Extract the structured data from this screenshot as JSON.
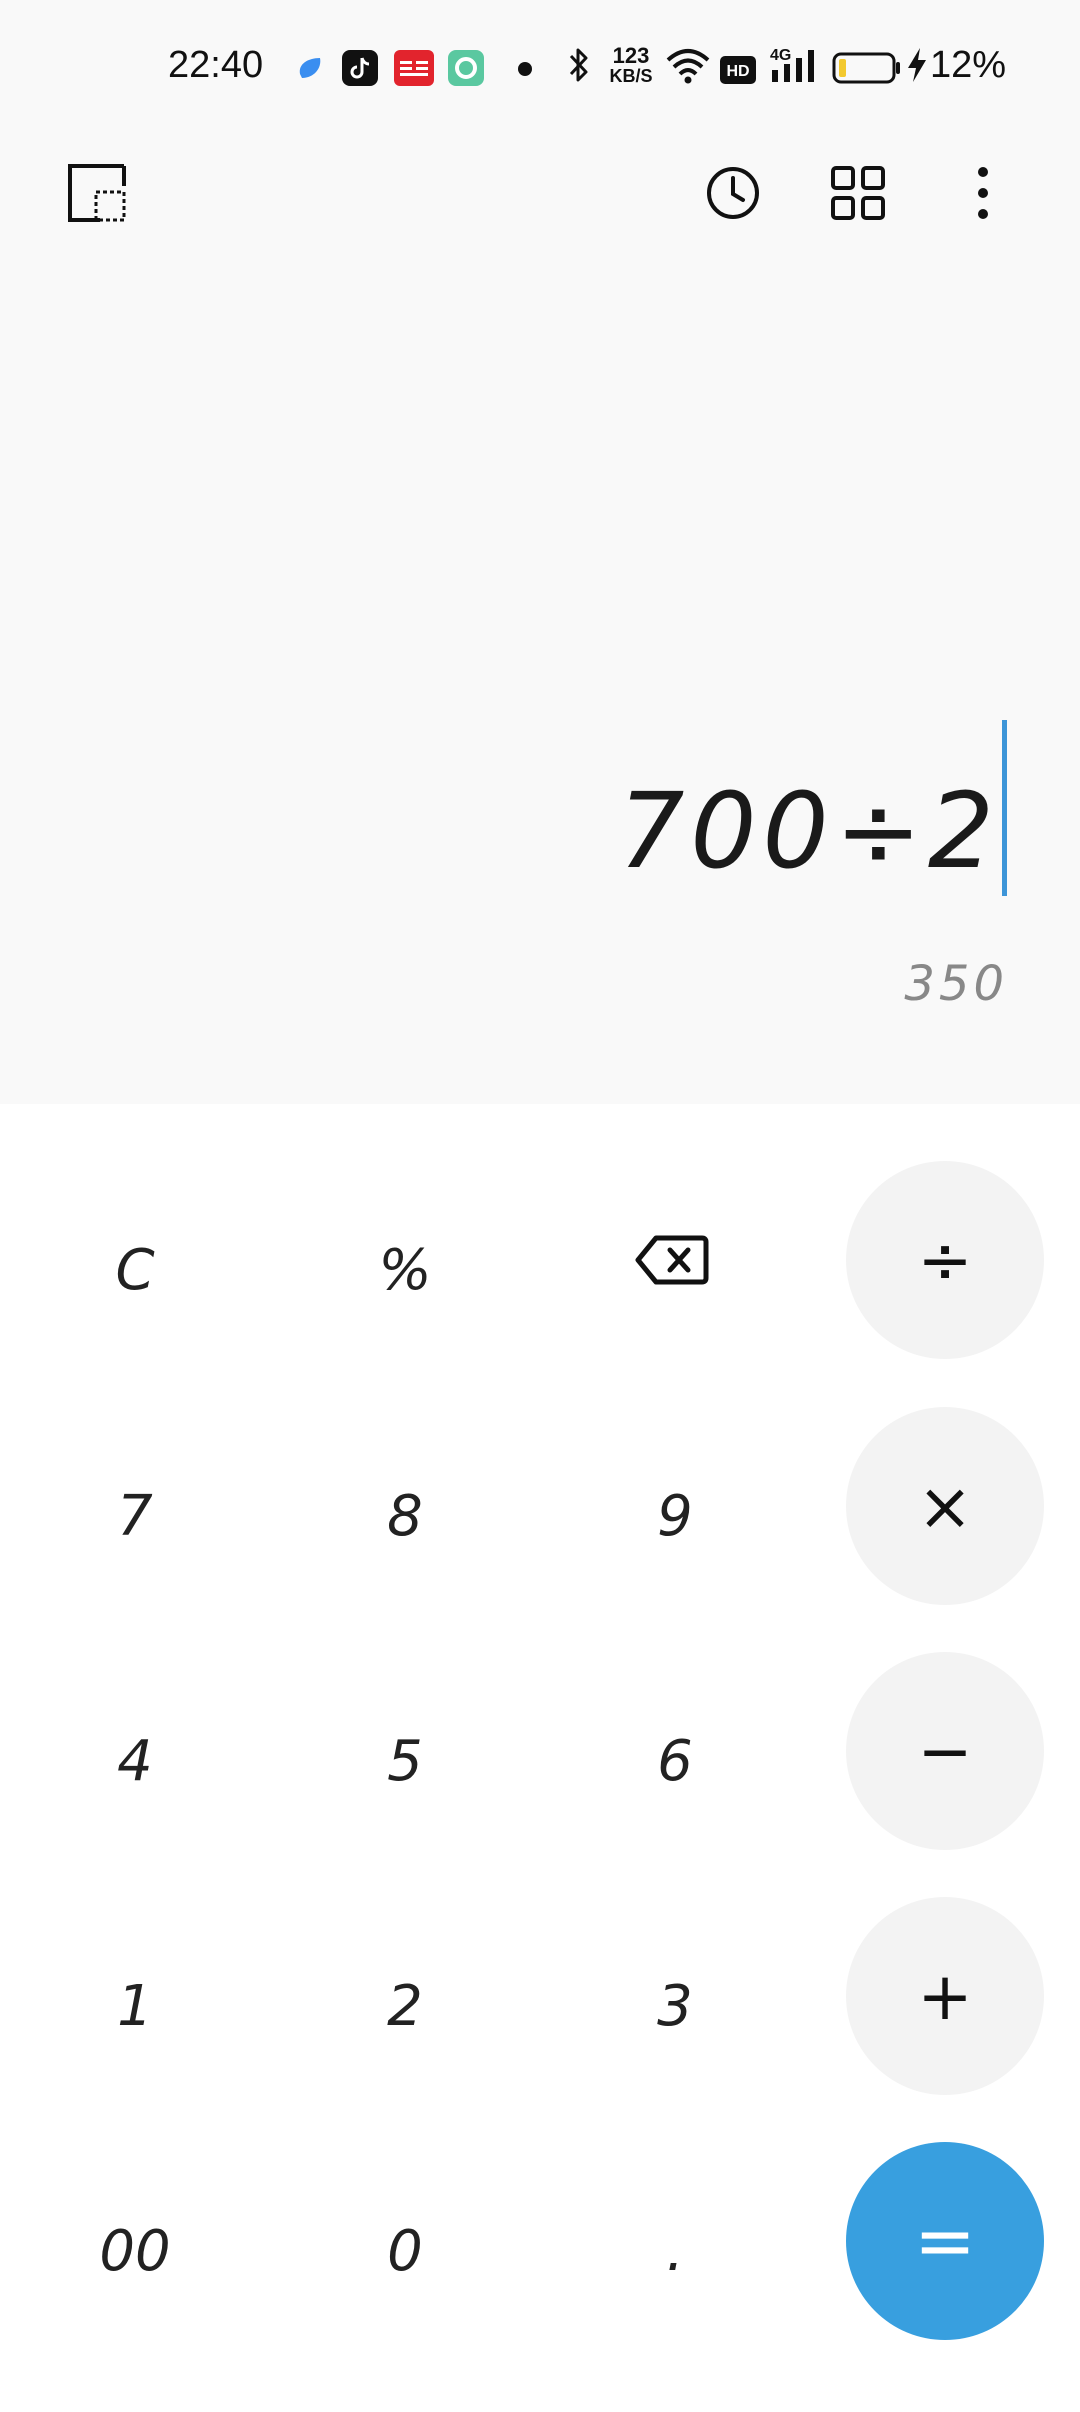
{
  "status_bar": {
    "time": "22:40",
    "network_speed_value": "123",
    "network_speed_unit": "KB/S",
    "hd_label": "HD",
    "network_type": "4G",
    "battery_percent": "12%",
    "icons": [
      "app-blue-icon",
      "tiktok-icon",
      "toutiao-icon",
      "green-app-icon",
      "bluetooth-icon",
      "wifi-icon",
      "hd-icon",
      "signal-icon",
      "battery-icon",
      "charging-icon"
    ]
  },
  "toolbar": {
    "icons": [
      "floating-window-icon",
      "history-icon",
      "grid-icon",
      "more-icon"
    ]
  },
  "display": {
    "expression": "700÷2",
    "result": "350"
  },
  "keys": {
    "clear": "C",
    "percent": "%",
    "seven": "7",
    "eight": "8",
    "nine": "9",
    "four": "4",
    "five": "5",
    "six": "6",
    "one": "1",
    "two": "2",
    "three": "3",
    "double_zero": "00",
    "zero": "0",
    "dot": ".",
    "divide": "÷",
    "multiply": "×",
    "minus": "−",
    "plus": "+",
    "equals": "="
  },
  "colors": {
    "accent": "#389fdf",
    "cursor": "#3d95d8",
    "background": "#f9f9f9",
    "keypad_background": "#ffffff",
    "operator_background": "#f3f3f3",
    "result_text": "#888888"
  }
}
